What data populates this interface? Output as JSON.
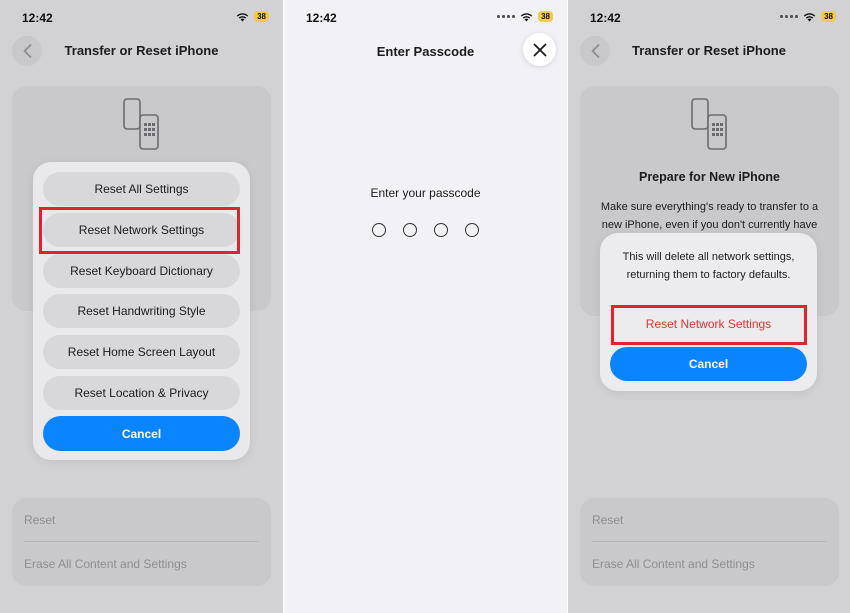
{
  "colors": {
    "accent": "#0a84ff",
    "highlight_box": "#e0242c",
    "destructive": "#e0342f",
    "battery": "#f2c94c"
  },
  "status_bar": {
    "time": "12:42",
    "battery": "38"
  },
  "left_panel": {
    "nav_title": "Transfer or Reset iPhone",
    "options": [
      "Reset All Settings",
      "Reset Network Settings",
      "Reset Keyboard Dictionary",
      "Reset Handwriting Style",
      "Reset Home Screen Layout",
      "Reset Location & Privacy"
    ],
    "cancel_label": "Cancel",
    "bottom_list": [
      "Reset",
      "Erase All Content and Settings"
    ]
  },
  "middle_panel": {
    "title": "Enter Passcode",
    "prompt": "Enter your passcode",
    "passcode_length": 4
  },
  "right_panel": {
    "nav_title": "Transfer or Reset iPhone",
    "card_title": "Prepare for New iPhone",
    "card_description": "Make sure everything's ready to transfer to a new iPhone, even if you don't currently have",
    "alert_message": "This will delete all network settings, returning them to factory defaults.",
    "alert_action": "Reset Network Settings",
    "cancel_label": "Cancel",
    "bottom_list": [
      "Reset",
      "Erase All Content and Settings"
    ]
  }
}
